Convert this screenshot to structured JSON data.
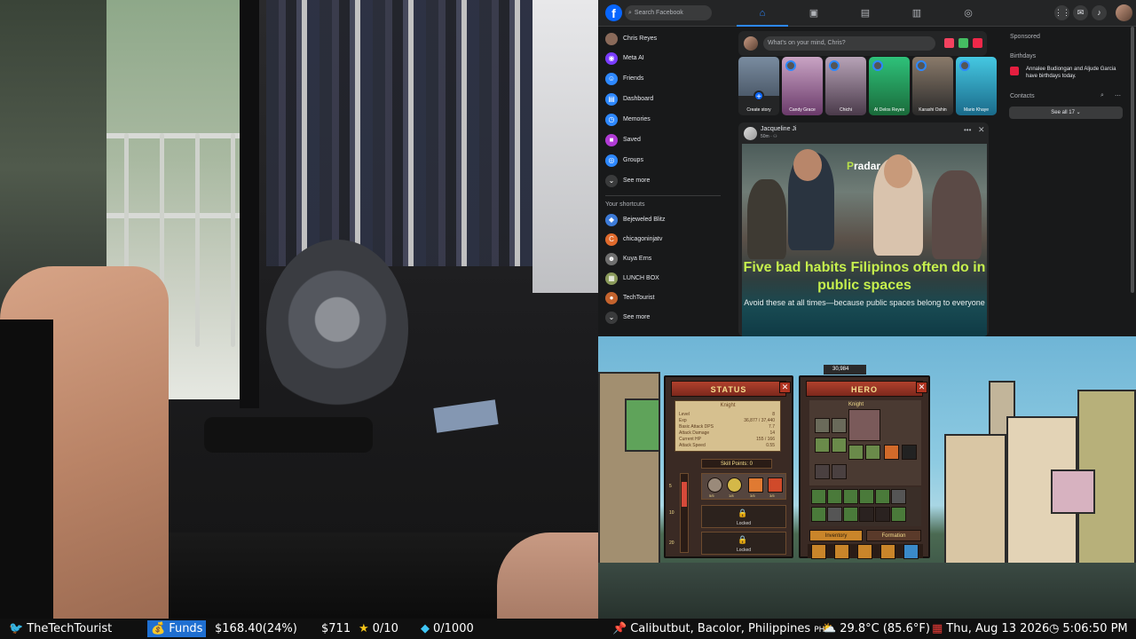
{
  "facebook": {
    "search_placeholder": "Search Facebook",
    "composer_placeholder": "What's on your mind, Chris?",
    "left_nav": [
      {
        "label": "Chris Reyes",
        "icon": "profile-avatar-icon",
        "color": "#8a6a5a"
      },
      {
        "label": "Meta AI",
        "icon": "meta-ai-icon",
        "color": "#7a3cff"
      },
      {
        "label": "Friends",
        "icon": "friends-icon",
        "color": "#2d88ff"
      },
      {
        "label": "Dashboard",
        "icon": "dashboard-icon",
        "color": "#2d88ff"
      },
      {
        "label": "Memories",
        "icon": "memories-icon",
        "color": "#2d88ff"
      },
      {
        "label": "Saved",
        "icon": "saved-icon",
        "color": "#b23bd6"
      },
      {
        "label": "Groups",
        "icon": "groups-icon",
        "color": "#2d88ff"
      },
      {
        "label": "See more",
        "icon": "chevron-down-icon",
        "color": "#3a3b3c"
      }
    ],
    "shortcuts_title": "Your shortcuts",
    "shortcuts": [
      {
        "label": "Bejeweled Blitz",
        "icon": "bejeweled-icon",
        "color": "#3d7bd8"
      },
      {
        "label": "chicagoninjatv",
        "icon": "c-icon",
        "color": "#e06a2c"
      },
      {
        "label": "Kuya Erns",
        "icon": "kuya-erns-icon",
        "color": "#6f6f6f"
      },
      {
        "label": "LUNCH BOX",
        "icon": "lunch-box-icon",
        "color": "#8a9a5a"
      },
      {
        "label": "TechTourist",
        "icon": "techtourist-icon",
        "color": "#c4632d"
      },
      {
        "label": "See more",
        "icon": "chevron-down-icon",
        "color": "#3a3b3c"
      }
    ],
    "stories": [
      {
        "name": "Create story",
        "color": "#242526"
      },
      {
        "name": "Candy Grace",
        "color": "#8a5a8a"
      },
      {
        "name": "Chichi",
        "color": "#7a6a7a"
      },
      {
        "name": "Al Delos Reyes",
        "color": "#2a9a5a"
      },
      {
        "name": "Karashi Oshin",
        "color": "#5a4a3a"
      },
      {
        "name": "Mario Khaye",
        "color": "#2aa3c2"
      }
    ],
    "post": {
      "author": "Jacqueline Ji",
      "time": "50m · ⚇",
      "brand_prefix": "P",
      "brand": "radar",
      "headline": "Five bad habits Filipinos often do in public spaces",
      "subline": "Avoid these at all times—because public spaces belong to everyone"
    },
    "right": {
      "sponsored": "Sponsored",
      "birthdays_title": "Birthdays",
      "birthday_text": "Annalee Budiongan and Aljude Garcia have birthdays today.",
      "contacts_title": "Contacts",
      "see_all": "See all 17 ⌄"
    }
  },
  "game": {
    "status_title": "STATUS",
    "hero_title": "HERO",
    "class_name": "Knight",
    "hero_class": "Knight",
    "gold": "30,984",
    "stats": [
      {
        "label": "Level",
        "value": "8"
      },
      {
        "label": "Exp",
        "value": "36,877 / 37,440"
      },
      {
        "label": "Basic Attack DPS",
        "value": "7.7"
      },
      {
        "label": "Attack Damage",
        "value": "14"
      },
      {
        "label": "Current HP",
        "value": "155 / 166"
      },
      {
        "label": "Attack Speed",
        "value": "0.55"
      }
    ],
    "skill_points": "Skill Points: 0",
    "locked": "Locked",
    "inventory_tab": "Inventory",
    "formation_tab": "Formation",
    "skill_levels": [
      "5/5",
      "1/8",
      "3/5",
      "3/5"
    ],
    "level_marks": [
      "5",
      "10",
      "20"
    ]
  },
  "stream_bar": {
    "channel": "TheTechTourist",
    "funds_label": "Funds",
    "funds_value": "$168.40(24%)",
    "money": "$711",
    "stars": "0/10",
    "gems": "0/1000",
    "location": "Calibutbut, Bacolor, Philippines",
    "country": "PH",
    "weather": "29.8°C (85.6°F)",
    "date": "Thu, Aug 13 2026",
    "time": "5:06:50 PM"
  }
}
